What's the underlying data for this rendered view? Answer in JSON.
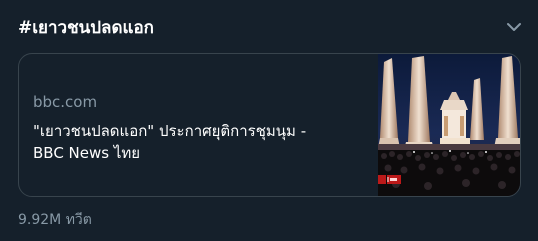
{
  "trend": {
    "hashtag": "#เยาวชนปลดแอก",
    "chevron_icon": "chevron-down-icon",
    "tweet_count": "9.92M ทวีต"
  },
  "card": {
    "domain": "bbc.com",
    "headline_line1": "\"เยาวชนปลดแอก\" ประกาศยุติการชุมนุม -",
    "headline_line2": "BBC News ไทย",
    "thumbnail": "democracy-monument-night-photo"
  },
  "colors": {
    "background": "#15202b",
    "border": "#38444d",
    "secondary_text": "#8899a6",
    "primary_text": "#ffffff"
  }
}
